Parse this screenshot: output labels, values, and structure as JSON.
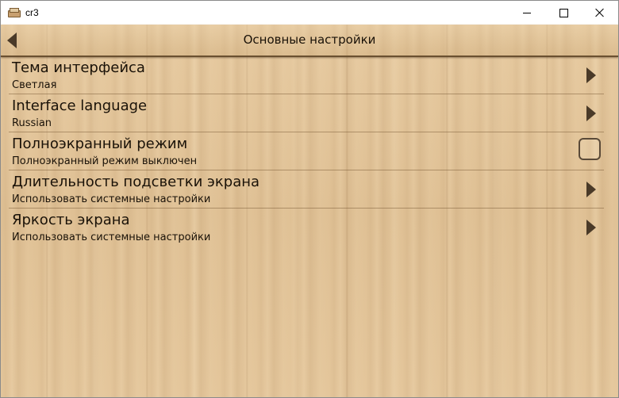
{
  "window": {
    "title": "cr3"
  },
  "header": {
    "title": "Основные настройки"
  },
  "settings": {
    "items": [
      {
        "title": "Тема интерфейса",
        "subtitle": "Светлая",
        "control": "chevron"
      },
      {
        "title": "Interface language",
        "subtitle": "Russian",
        "control": "chevron"
      },
      {
        "title": "Полноэкранный режим",
        "subtitle": "Полноэкранный режим выключен",
        "control": "checkbox",
        "checked": false
      },
      {
        "title": "Длительность подсветки экрана",
        "subtitle": "Использовать системные настройки",
        "control": "chevron"
      },
      {
        "title": "Яркость экрана",
        "subtitle": "Использовать системные настройки",
        "control": "chevron"
      }
    ]
  },
  "icons": {
    "app": "books-icon",
    "back": "back-arrow-icon",
    "chevron": "chevron-right-icon"
  },
  "colors": {
    "wood": "#e2c49a",
    "text": "#1a1208",
    "arrow": "#4a3a28"
  }
}
